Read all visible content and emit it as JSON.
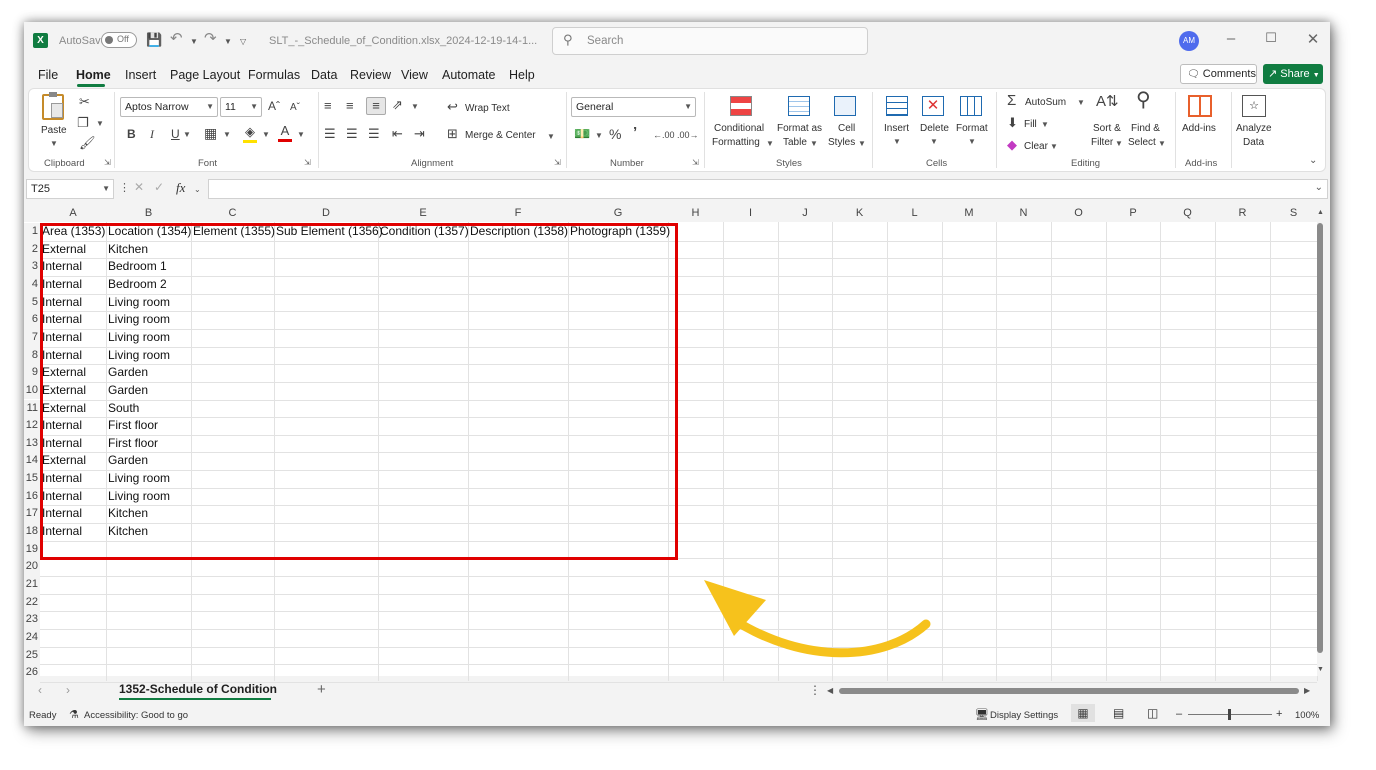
{
  "window": {
    "title": "SLT_-_Schedule_of_Condition.xlsx_2024-12-19-14-1...",
    "autosave_label": "AutoSave",
    "autosave_state": "Off",
    "search_placeholder": "Search",
    "avatar_initials": "AM"
  },
  "menu": {
    "tabs": [
      "File",
      "Home",
      "Insert",
      "Page Layout",
      "Formulas",
      "Data",
      "Review",
      "View",
      "Automate",
      "Help"
    ],
    "active": "Home",
    "comments_label": "Comments",
    "share_label": "Share"
  },
  "ribbon": {
    "clipboard": {
      "paste": "Paste",
      "group": "Clipboard"
    },
    "font": {
      "name": "Aptos Narrow",
      "size": "11",
      "group": "Font",
      "bold": "B",
      "italic": "I",
      "underline": "U"
    },
    "alignment": {
      "wrap_text": "Wrap Text",
      "merge_center": "Merge & Center",
      "group": "Alignment"
    },
    "number": {
      "format": "General",
      "group": "Number"
    },
    "styles": {
      "conditional_1": "Conditional",
      "conditional_2": "Formatting",
      "format_table_1": "Format as",
      "format_table_2": "Table",
      "cell_styles_1": "Cell",
      "cell_styles_2": "Styles",
      "group": "Styles"
    },
    "cells": {
      "insert": "Insert",
      "delete": "Delete",
      "format": "Format",
      "group": "Cells"
    },
    "editing": {
      "autosum": "AutoSum",
      "fill": "Fill",
      "clear": "Clear",
      "sort_1": "Sort &",
      "sort_2": "Filter",
      "find_1": "Find &",
      "find_2": "Select",
      "group": "Editing"
    },
    "addins": {
      "label": "Add-ins",
      "group": "Add-ins"
    },
    "analyze": {
      "label_1": "Analyze",
      "label_2": "Data"
    }
  },
  "formula_bar": {
    "name_box": "T25",
    "fx": "fx",
    "value": ""
  },
  "grid": {
    "columns": [
      "A",
      "B",
      "C",
      "D",
      "E",
      "F",
      "G",
      "H",
      "I",
      "J",
      "K",
      "L",
      "M",
      "N",
      "O",
      "P",
      "Q",
      "R",
      "S"
    ],
    "row_numbers": [
      "1",
      "2",
      "3",
      "4",
      "5",
      "6",
      "7",
      "8",
      "9",
      "10",
      "11",
      "12",
      "13",
      "14",
      "15",
      "16",
      "17",
      "18",
      "19",
      "20",
      "21",
      "22",
      "23",
      "24",
      "25",
      "26"
    ],
    "header_row": [
      "Area (1353)",
      "Location (1354)",
      "Element (1355)",
      "Sub Element (1356)",
      "Condition (1357)",
      "Description (1358)",
      "Photograph (1359)"
    ],
    "data_rows": [
      [
        "External",
        "Kitchen"
      ],
      [
        "Internal",
        "Bedroom 1"
      ],
      [
        "Internal",
        "Bedroom 2"
      ],
      [
        "Internal",
        "Living room"
      ],
      [
        "Internal",
        "Living room"
      ],
      [
        "Internal",
        "Living room"
      ],
      [
        "Internal",
        "Living room"
      ],
      [
        "External",
        "Garden"
      ],
      [
        "External",
        "Garden"
      ],
      [
        "External",
        "South"
      ],
      [
        "Internal",
        "First floor"
      ],
      [
        "Internal",
        "First floor"
      ],
      [
        "External",
        "Garden"
      ],
      [
        "Internal",
        "Living room"
      ],
      [
        "Internal",
        "Living room"
      ],
      [
        "Internal",
        "Kitchen"
      ],
      [
        "Internal",
        "Kitchen"
      ]
    ]
  },
  "sheets": {
    "active_tab": "1352-Schedule of Condition",
    "add_label": "+"
  },
  "status_bar": {
    "ready": "Ready",
    "accessibility": "Accessibility: Good to go",
    "display_settings": "Display Settings",
    "zoom": "100%"
  },
  "colors": {
    "excel_green": "#107c41",
    "highlight_red": "#e00000",
    "arrow_yellow": "#f6c21c"
  }
}
